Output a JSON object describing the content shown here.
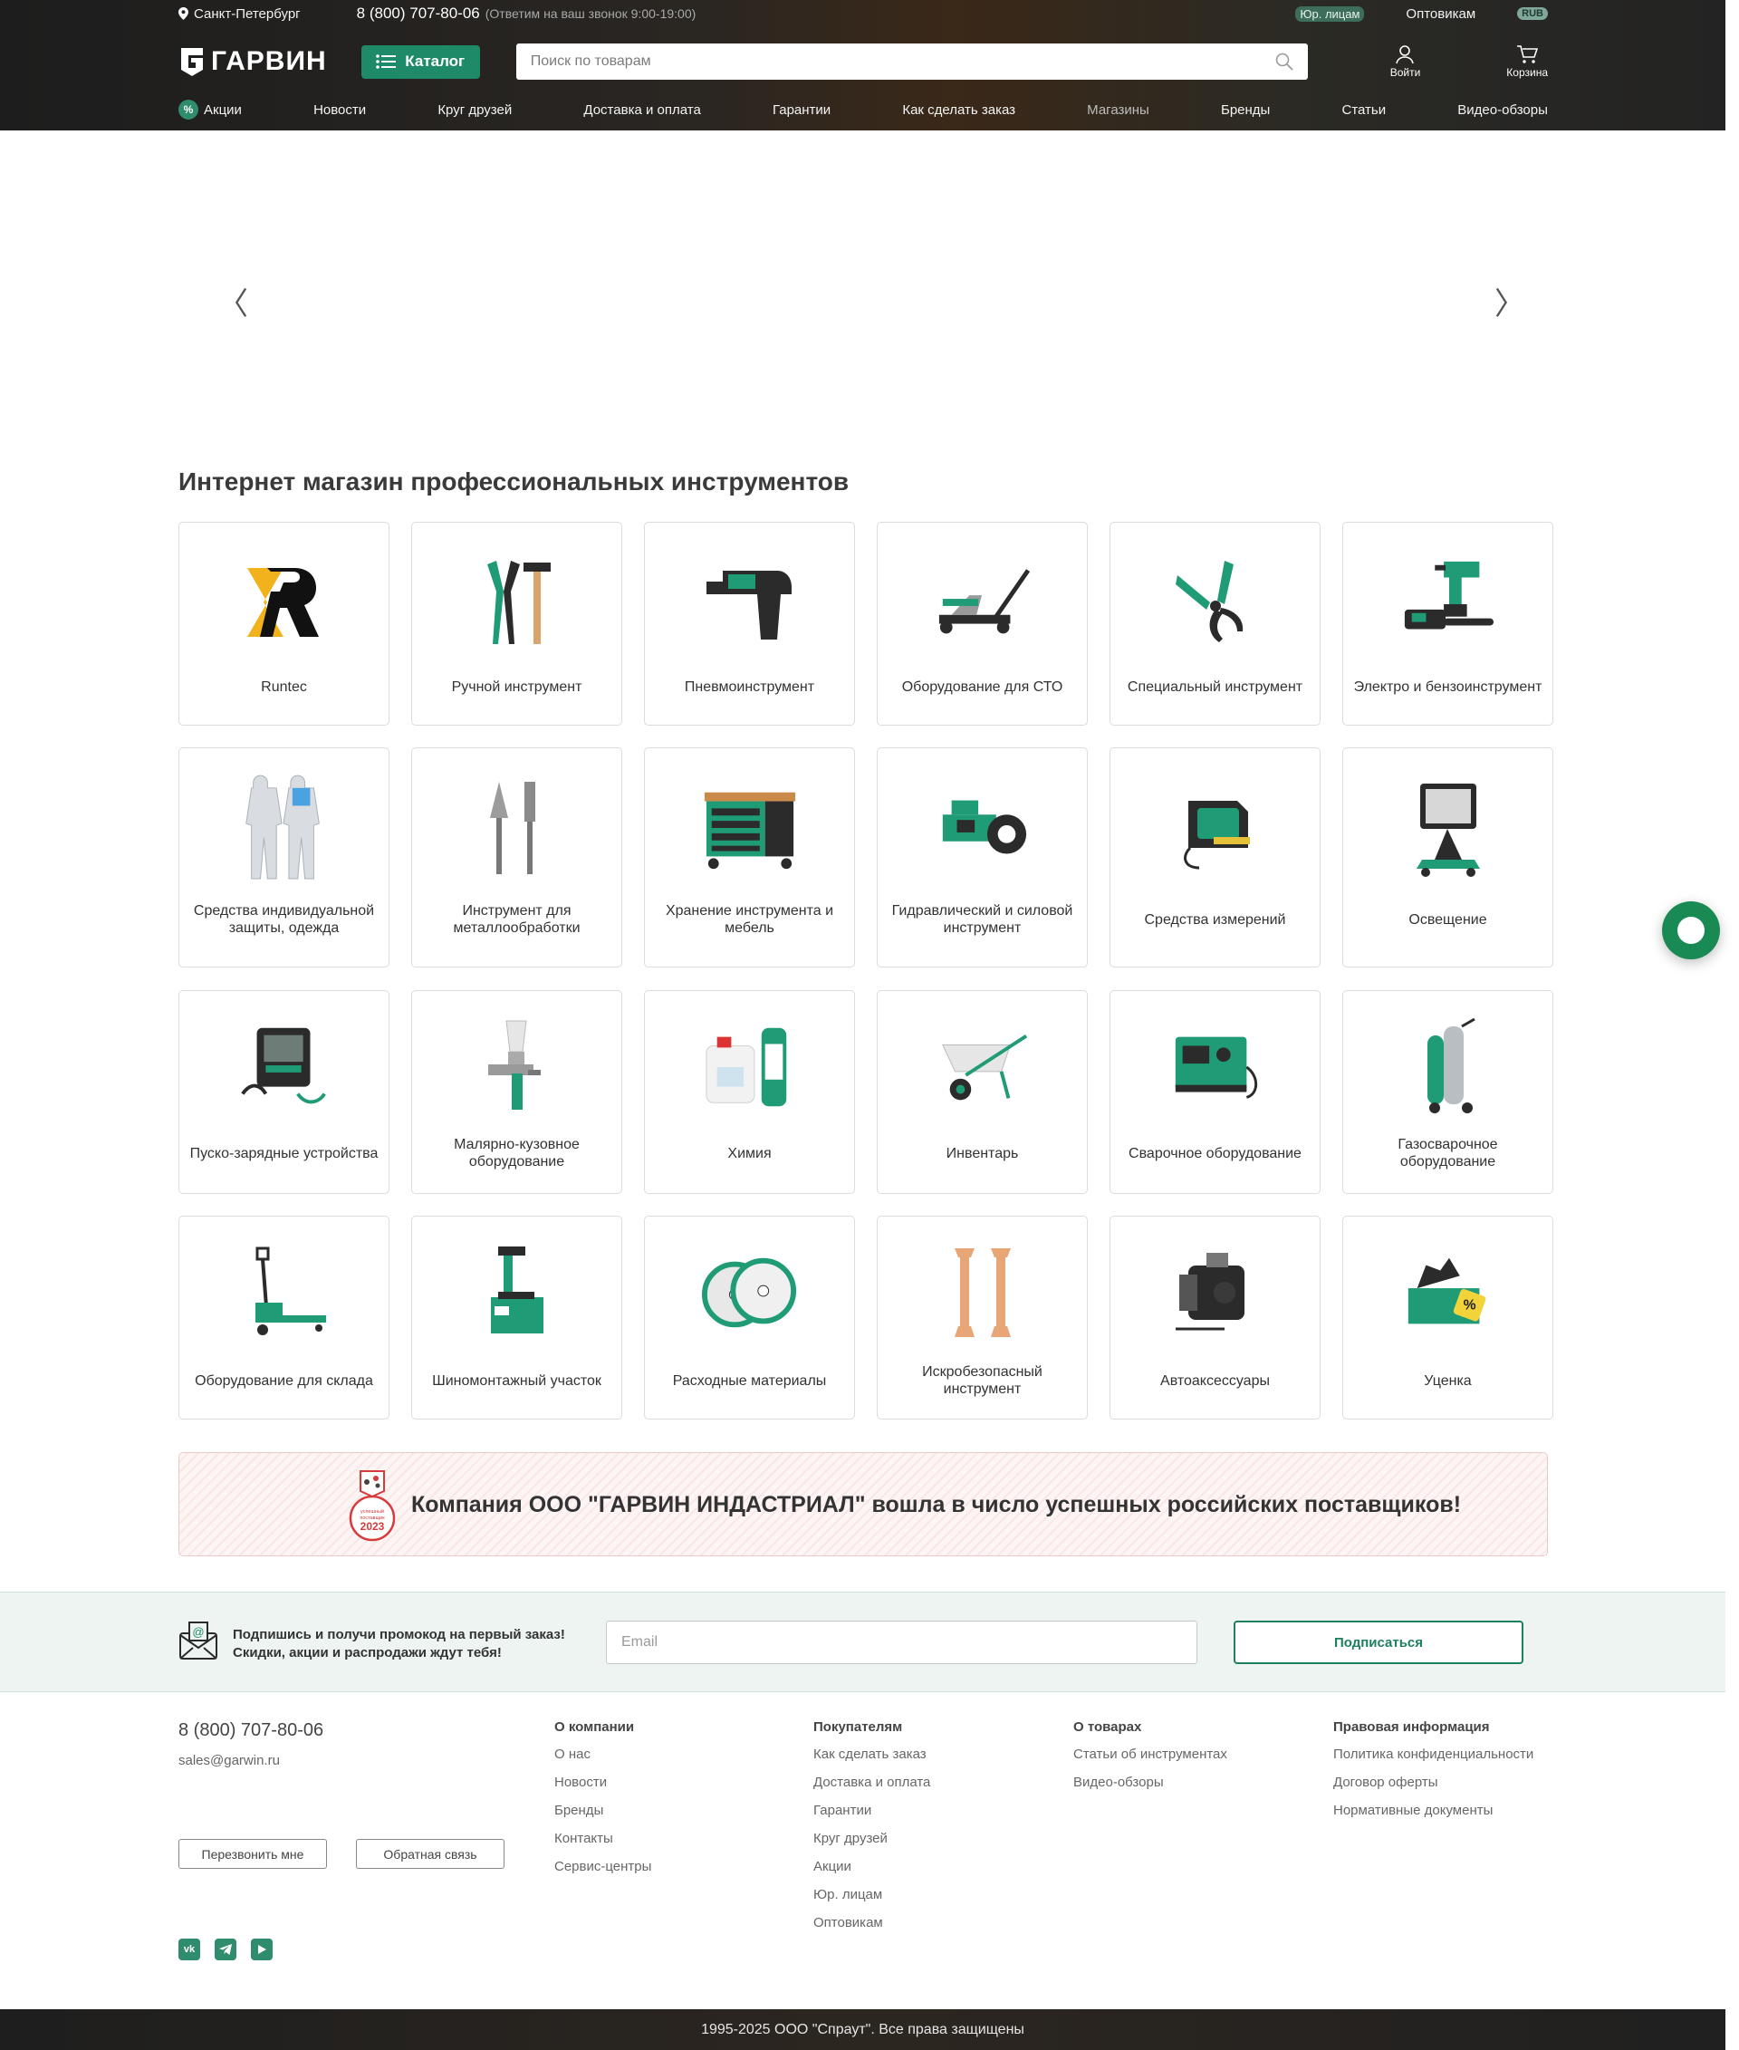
{
  "header": {
    "city": "Санкт-Петербург",
    "phone": "8 (800) 707-80-06",
    "phone_hint": "(Ответим на ваш звонок 9:00-19:00)",
    "legal_entities": "Юр. лицам",
    "wholesale": "Оптовикам",
    "currency": "RUB",
    "logo_text": "ГАРВИН",
    "catalog_label": "Каталог",
    "search_placeholder": "Поиск по товарам",
    "login_label": "Войти",
    "cart_label": "Корзина",
    "nav": [
      {
        "label": "Акции",
        "icon": "percent-icon"
      },
      {
        "label": "Новости"
      },
      {
        "label": "Круг друзей"
      },
      {
        "label": "Доставка и оплата"
      },
      {
        "label": "Гарантии"
      },
      {
        "label": "Как сделать заказ"
      },
      {
        "label": "Магазины"
      },
      {
        "label": "Бренды"
      },
      {
        "label": "Статьи"
      },
      {
        "label": "Видео-обзоры"
      }
    ]
  },
  "slider": {
    "prev": "〈",
    "next": "〉"
  },
  "section_title": "Интернет магазин профессиональных инструментов",
  "categories": [
    {
      "label": "Runtec",
      "icon": "runtec-logo"
    },
    {
      "label": "Ручной инструмент",
      "icon": "pliers-hammer-icon"
    },
    {
      "label": "Пневмоинструмент",
      "icon": "impact-wrench-icon"
    },
    {
      "label": "Оборудование для СТО",
      "icon": "floor-jack-icon"
    },
    {
      "label": "Специальный инструмент",
      "icon": "special-pliers-icon"
    },
    {
      "label": "Электро и бензоинструмент",
      "icon": "drill-chainsaw-icon"
    },
    {
      "label": "Средства индивидуальной защиты, одежда",
      "icon": "coverall-icon"
    },
    {
      "label": "Инструмент для металлообработки",
      "icon": "burr-bits-icon"
    },
    {
      "label": "Хранение инструмента и мебель",
      "icon": "workbench-icon"
    },
    {
      "label": "Гидравлический и силовой инструмент",
      "icon": "hydraulic-wrench-icon"
    },
    {
      "label": "Средства измерений",
      "icon": "tape-measure-icon"
    },
    {
      "label": "Освещение",
      "icon": "floodlight-icon"
    },
    {
      "label": "Пуско-зарядные устройства",
      "icon": "jump-starter-icon"
    },
    {
      "label": "Малярно-кузовное оборудование",
      "icon": "spray-gun-icon"
    },
    {
      "label": "Химия",
      "icon": "chemicals-icon"
    },
    {
      "label": "Инвентарь",
      "icon": "wheelbarrow-icon"
    },
    {
      "label": "Сварочное оборудование",
      "icon": "welder-icon"
    },
    {
      "label": "Газосварочное оборудование",
      "icon": "gas-cylinder-icon"
    },
    {
      "label": "Оборудование для склада",
      "icon": "pallet-jack-icon"
    },
    {
      "label": "Шиномонтажный участок",
      "icon": "tire-changer-icon"
    },
    {
      "label": "Расходные материалы",
      "icon": "cutting-discs-icon"
    },
    {
      "label": "Искробезопасный инструмент",
      "icon": "spark-free-wrench-icon"
    },
    {
      "label": "Автоаксессуары",
      "icon": "compressor-icon"
    },
    {
      "label": "Уценка",
      "icon": "discount-toolbox-icon"
    }
  ],
  "banner": {
    "text": "Компания ООО \"ГАРВИН ИНДАСТРИАЛ\" вошла в число успешных российских поставщиков!",
    "badge_top": "успешный поставщик",
    "badge_year": "2023"
  },
  "subscribe": {
    "line1": "Подпишись и получи промокод на первый заказ!",
    "line2": "Скидки, акции и распродажи ждут тебя!",
    "email_placeholder": "Email",
    "button": "Подписаться"
  },
  "footer": {
    "phone": "8 (800) 707-80-06",
    "email": "sales@garwin.ru",
    "call_me": "Перезвонить мне",
    "feedback": "Обратная связь",
    "social": [
      "vk-icon",
      "telegram-icon",
      "youtube-icon"
    ],
    "columns": [
      {
        "title": "О компании",
        "links": [
          "О нас",
          "Новости",
          "Бренды",
          "Контакты",
          "Сервис-центры"
        ]
      },
      {
        "title": "Покупателям",
        "links": [
          "Как сделать заказ",
          "Доставка и оплата",
          "Гарантии",
          "Круг друзей",
          "Акции",
          "Юр. лицам",
          "Оптовикам"
        ]
      },
      {
        "title": "О товарах",
        "links": [
          "Статьи об инструментах",
          "Видео-обзоры"
        ]
      },
      {
        "title": "Правовая информация",
        "links": [
          "Политика конфиденциальности",
          "Договор оферты",
          "Нормативные документы"
        ]
      }
    ],
    "copyright": "1995-2025 ООО \"Спраут\". Все права защищены"
  },
  "colors": {
    "accent": "#1f8a67",
    "header_bg": "#232323",
    "chat": "#1a8a55"
  }
}
